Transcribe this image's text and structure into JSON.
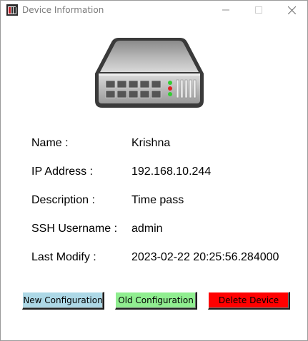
{
  "window": {
    "title": "Device Information",
    "app_icon": "device-app-icon",
    "controls": {
      "minimize_icon": "minimize-icon",
      "maximize_icon": "maximize-icon",
      "close_icon": "close-icon"
    }
  },
  "device_image": {
    "icon": "network-switch-icon"
  },
  "fields": [
    {
      "label": "Name :",
      "value": "Krishna"
    },
    {
      "label": "IP Address :",
      "value": "192.168.10.244"
    },
    {
      "label": "Description :",
      "value": "Time pass"
    },
    {
      "label": "SSH Username :",
      "value": "admin"
    },
    {
      "label": "Last Modify :",
      "value": "2023-02-22 20:25:56.284000"
    }
  ],
  "buttons": {
    "new_config": {
      "label": "New Configuration",
      "color": "#add8e6",
      "text_color": "#000000"
    },
    "old_config": {
      "label": "Old Configuration",
      "color": "#90ee90",
      "text_color": "#000000"
    },
    "delete_device": {
      "label": "Delete Device",
      "color": "#ff0000",
      "text_color": "#000000"
    }
  }
}
